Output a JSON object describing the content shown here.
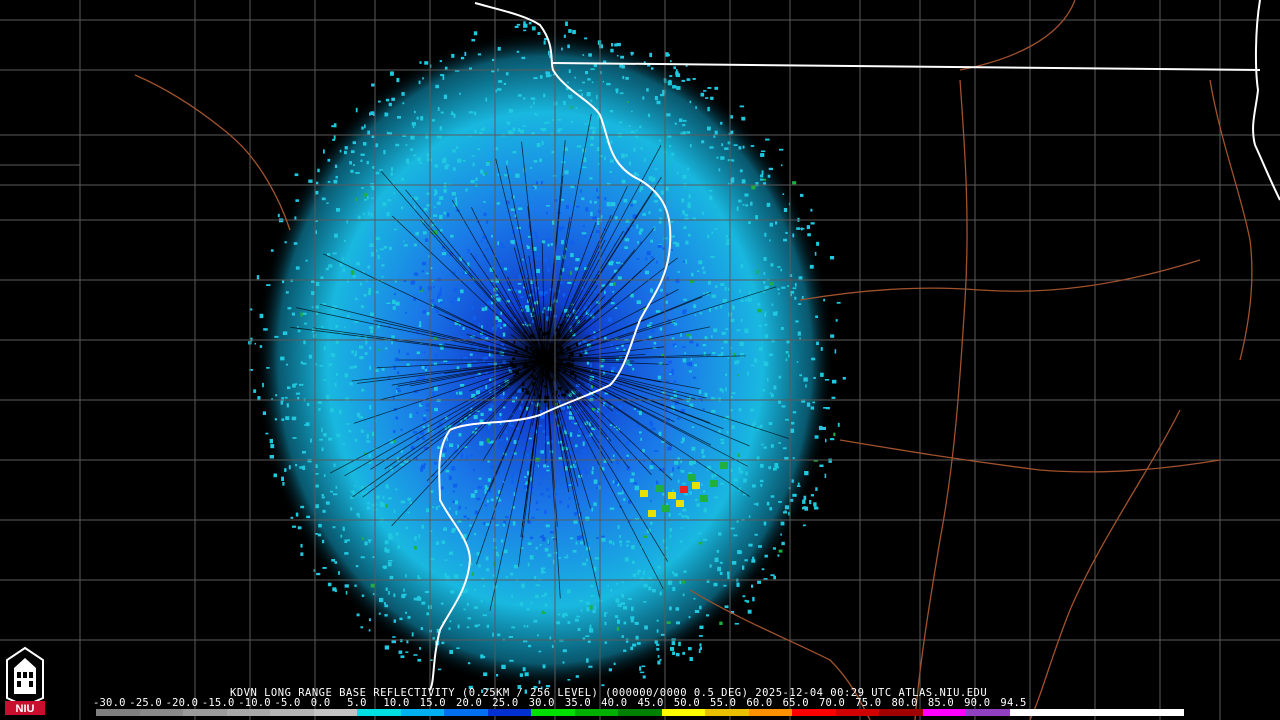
{
  "product_line": "KDVN LONG RANGE BASE REFLECTIVITY (0.25KM / 256 LEVEL) (000000/0000 0.5 DEG) 2025-12-04 00:29 UTC  ATLAS.NIU.EDU",
  "logo": {
    "text": "NIU",
    "icon": "niu-seal-icon",
    "color": "#c8102e"
  },
  "scale": {
    "labels": [
      "-30.0",
      "-25.0",
      "-20.0",
      "-15.0",
      "-10.0",
      "-5.0",
      "0.0",
      "5.0",
      "10.0",
      "15.0",
      "20.0",
      "25.0",
      "30.0",
      "35.0",
      "40.0",
      "45.0",
      "50.0",
      "55.0",
      "60.0",
      "65.0",
      "70.0",
      "75.0",
      "80.0",
      "85.0",
      "90.0",
      "94.5"
    ],
    "colors": [
      "#7f7f7f",
      "#8a8a8a",
      "#9a9a9a",
      "#a8a8a8",
      "#b5b5b5",
      "#c4c4c4",
      "#00e0e0",
      "#00b0f0",
      "#0070f0",
      "#0030d0",
      "#00e000",
      "#00b000",
      "#008000",
      "#ffff00",
      "#e8c000",
      "#ff9000",
      "#ff0000",
      "#d00000",
      "#a00000",
      "#ff00ff",
      "#9040c0",
      "#ffffff",
      "#ffffff",
      "#ffffff",
      "#ffffff"
    ]
  },
  "map_colors": {
    "background": "#000000",
    "county_lines": "#5a5a5a",
    "state_lines": "#ffffff",
    "rivers": "#a0522d",
    "echo_light": "#20c8e0",
    "echo_mid": "#1060f0",
    "echo_green": "#20b040",
    "echo_yellow": "#e8e000",
    "echo_red": "#f02020"
  }
}
